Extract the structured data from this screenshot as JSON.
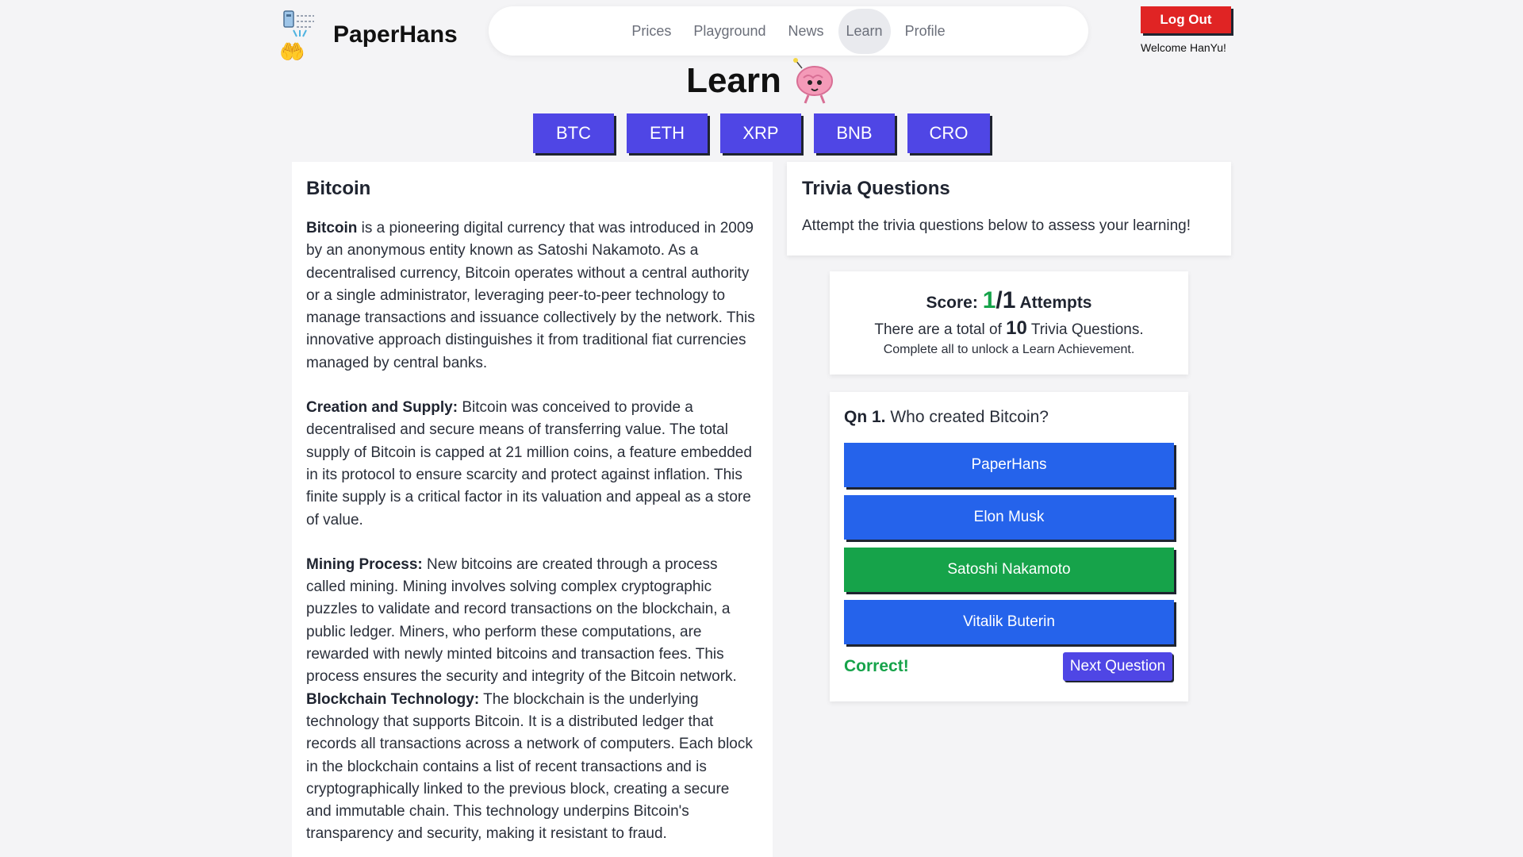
{
  "brand": {
    "name": "PaperHans"
  },
  "nav": {
    "items": [
      {
        "label": "Prices"
      },
      {
        "label": "Playground"
      },
      {
        "label": "News"
      },
      {
        "label": "Learn"
      },
      {
        "label": "Profile"
      }
    ],
    "active": "Learn"
  },
  "account": {
    "logout_label": "Log Out",
    "welcome": "Welcome HanYu!"
  },
  "page": {
    "title": "Learn"
  },
  "coins": [
    "BTC",
    "ETH",
    "XRP",
    "BNB",
    "CRO"
  ],
  "article": {
    "heading": "Bitcoin",
    "sections": [
      {
        "bold": "Bitcoin",
        "text": " is a pioneering digital currency that was introduced in 2009 by an anonymous entity known as Satoshi Nakamoto. As a decentralised currency, Bitcoin operates without a central authority or a single administrator, leveraging peer-to-peer technology to manage transactions and issuance collectively by the network. This innovative approach distinguishes it from traditional fiat currencies managed by central banks."
      },
      {
        "bold": "Creation and Supply:",
        "text": " Bitcoin was conceived to provide a decentralised and secure means of transferring value. The total supply of Bitcoin is capped at 21 million coins, a feature embedded in its protocol to ensure scarcity and protect against inflation. This finite supply is a critical factor in its valuation and appeal as a store of value."
      },
      {
        "bold": "Mining Process:",
        "text": " New bitcoins are created through a process called mining. Mining involves solving complex cryptographic puzzles to validate and record transactions on the blockchain, a public ledger. Miners, who perform these computations, are rewarded with newly minted bitcoins and transaction fees. This process ensures the security and integrity of the Bitcoin network."
      },
      {
        "bold": "Blockchain Technology:",
        "text": " The blockchain is the underlying technology that supports Bitcoin. It is a distributed ledger that records all transactions across a network of computers. Each block in the blockchain contains a list of recent transactions and is cryptographically linked to the previous block, creating a secure and immutable chain. This technology underpins Bitcoin's transparency and security, making it resistant to fraud."
      }
    ]
  },
  "trivia": {
    "heading": "Trivia Questions",
    "intro": "Attempt the trivia questions below to assess your learning!"
  },
  "score": {
    "label": "Score:",
    "correct": "1",
    "slash_total": "/1",
    "attempts_label": "Attempts",
    "total_prefix": "There are a total of",
    "total_count": "10",
    "total_suffix": "Trivia Questions.",
    "subtext": "Complete all to unlock a Learn Achievement."
  },
  "question": {
    "number": "Qn 1.",
    "text": "Who created Bitcoin?",
    "options": [
      "PaperHans",
      "Elon Musk",
      "Satoshi Nakamoto",
      "Vitalik Buterin"
    ],
    "correct_index": 2,
    "feedback": "Correct!",
    "next_label": "Next Question"
  },
  "colors": {
    "primary": "#4f46e5",
    "option_blue": "#2563eb",
    "correct_green": "#16a34a",
    "logout_red": "#e02424"
  }
}
